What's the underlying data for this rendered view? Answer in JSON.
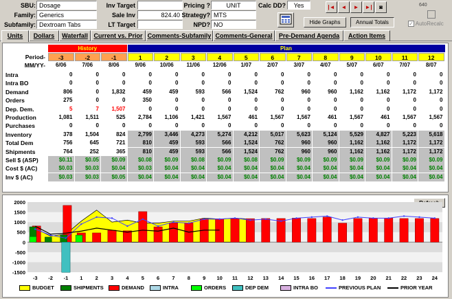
{
  "header": {
    "sbu_label": "SBU:",
    "sbu_value": "Dosage",
    "family_label": "Family:",
    "family_value": "Generics",
    "subfamily_label": "Subfamily:",
    "subfamily_value": "Dextroam Tabs",
    "inv_target_label": "Inv Target",
    "inv_target_value": "",
    "sale_inv_label": "Sale Inv",
    "sale_inv_value": "824.40",
    "lt_target_label": "LT Target",
    "lt_target_value": "",
    "pricing_label": "Pricing ?",
    "pricing_value": "UNIT",
    "strategy_label": "Strategy?",
    "strategy_value": "MTS",
    "npd_label": "NPD?",
    "npd_value": "NO",
    "calc_dd_label": "Calc DD?",
    "calc_dd_value": "Yes",
    "hide_graphs_label": "Hide Graphs",
    "annual_totals_label": "Annual Totals",
    "autorecalc_label": "AutoRecalc",
    "corner_number": "640"
  },
  "tabs": [
    "Units",
    "Dollars",
    "Waterfall",
    "Current vs. Prior",
    "Comments-Subfamily",
    "Comments-General",
    "Pre-Demand Agenda",
    "Action Items"
  ],
  "grid": {
    "history_label": "History",
    "plan_label": "Plan",
    "period_label": "Period-",
    "mmyy_label": "MM/YY-",
    "periods": [
      "-3",
      "-2",
      "-1",
      "1",
      "2",
      "3",
      "4",
      "5",
      "6",
      "7",
      "8",
      "9",
      "10",
      "11",
      "12"
    ],
    "dates": [
      "6/06",
      "7/06",
      "8/06",
      "9/06",
      "10/06",
      "11/06",
      "12/06",
      "1/07",
      "2/07",
      "3/07",
      "4/07",
      "5/07",
      "6/07",
      "7/07",
      "8/07"
    ],
    "rows": [
      {
        "label": "Intra",
        "values": [
          "0",
          "0",
          "0",
          "0",
          "0",
          "0",
          "0",
          "0",
          "0",
          "0",
          "0",
          "0",
          "0",
          "0",
          "0"
        ]
      },
      {
        "label": "Intra BO",
        "values": [
          "0",
          "0",
          "0",
          "0",
          "0",
          "0",
          "0",
          "0",
          "0",
          "0",
          "0",
          "0",
          "0",
          "0",
          "0"
        ]
      },
      {
        "label": "Demand",
        "values": [
          "806",
          "0",
          "1,832",
          "459",
          "459",
          "593",
          "566",
          "1,524",
          "762",
          "960",
          "960",
          "1,162",
          "1,162",
          "1,172",
          "1,172"
        ]
      },
      {
        "label": "Orders",
        "values": [
          "275",
          "0",
          "0",
          "350",
          "0",
          "0",
          "0",
          "0",
          "0",
          "0",
          "0",
          "0",
          "0",
          "0",
          "0"
        ]
      },
      {
        "label": "Dep. Dem.",
        "values": [
          "5",
          "7",
          "1,507",
          "0",
          "0",
          "0",
          "0",
          "0",
          "0",
          "0",
          "0",
          "0",
          "0",
          "0",
          "0"
        ]
      },
      {
        "label": "Production",
        "values": [
          "1,081",
          "1,511",
          "525",
          "2,784",
          "1,106",
          "1,421",
          "1,567",
          "461",
          "1,567",
          "1,567",
          "461",
          "1,567",
          "461",
          "1,567",
          "1,567"
        ]
      },
      {
        "label": "Purchases",
        "values": [
          "0",
          "0",
          "0",
          "0",
          "0",
          "0",
          "0",
          "0",
          "0",
          "0",
          "0",
          "0",
          "0",
          "0",
          "0"
        ]
      },
      {
        "label": "Inventory",
        "values": [
          "378",
          "1,504",
          "824",
          "2,799",
          "3,446",
          "4,273",
          "5,274",
          "4,212",
          "5,017",
          "5,623",
          "5,124",
          "5,529",
          "4,827",
          "5,223",
          "5,618"
        ]
      },
      {
        "label": "Total Dem",
        "values": [
          "756",
          "645",
          "721",
          "810",
          "459",
          "593",
          "566",
          "1,524",
          "762",
          "960",
          "960",
          "1,162",
          "1,162",
          "1,172",
          "1,172"
        ]
      },
      {
        "label": "Shipments",
        "values": [
          "764",
          "252",
          "365",
          "810",
          "459",
          "593",
          "566",
          "1,524",
          "762",
          "960",
          "960",
          "1,162",
          "1,162",
          "1,172",
          "1,172"
        ]
      },
      {
        "label": "Sell $ (ASP)",
        "values": [
          "$0.11",
          "$0.05",
          "$0.09",
          "$0.08",
          "$0.09",
          "$0.08",
          "$0.09",
          "$0.08",
          "$0.09",
          "$0.09",
          "$0.09",
          "$0.09",
          "$0.09",
          "$0.09",
          "$0.09"
        ]
      },
      {
        "label": "Cost $ (AC)",
        "values": [
          "$0.03",
          "$0.03",
          "$0.04",
          "$0.03",
          "$0.04",
          "$0.04",
          "$0.04",
          "$0.04",
          "$0.04",
          "$0.04",
          "$0.04",
          "$0.04",
          "$0.04",
          "$0.04",
          "$0.04"
        ]
      },
      {
        "label": "Inv $ (AC)",
        "values": [
          "$0.03",
          "$0.03",
          "$0.05",
          "$0.04",
          "$0.04",
          "$0.04",
          "$0.04",
          "$0.04",
          "$0.04",
          "$0.04",
          "$0.04",
          "$0.04",
          "$0.04",
          "$0.04",
          "$0.04"
        ]
      }
    ]
  },
  "chart_data": {
    "type": "bar",
    "refresh_label": "Refresh",
    "categories": [
      "-3",
      "-2",
      "-1",
      "1",
      "2",
      "3",
      "4",
      "5",
      "6",
      "7",
      "8",
      "9",
      "10",
      "11",
      "12",
      "13",
      "14",
      "15",
      "16",
      "17",
      "18",
      "19",
      "20",
      "21",
      "22",
      "23",
      "24"
    ],
    "ylim": [
      -1500,
      2000
    ],
    "yticks": [
      "2000",
      "1500",
      "1000",
      "500",
      "0",
      "-500",
      "-1000",
      "-1500"
    ],
    "series": [
      {
        "name": "BUDGET",
        "color": "#ffff00",
        "values": [
          700,
          300,
          400,
          1050,
          1600,
          1000,
          1100,
          950,
          950,
          1050,
          1050,
          1200,
          1150,
          1200,
          1150,
          null,
          null,
          null,
          null,
          null,
          null,
          null,
          null,
          null,
          null,
          null,
          null
        ]
      },
      {
        "name": "SHIPMENTS",
        "color": "#008000",
        "values": [
          764,
          252,
          365,
          null,
          null,
          null,
          null,
          null,
          null,
          null,
          null,
          null,
          null,
          null,
          null,
          null,
          null,
          null,
          null,
          null,
          null,
          null,
          null,
          null,
          null,
          null,
          null
        ]
      },
      {
        "name": "DEMAND",
        "color": "#ff0000",
        "values": [
          806,
          0,
          1832,
          459,
          459,
          593,
          566,
          1524,
          762,
          960,
          960,
          1162,
          1162,
          1172,
          1172,
          1180,
          1180,
          1200,
          1180,
          1250,
          950,
          1180,
          1200,
          1200,
          1180,
          1180,
          1180
        ]
      },
      {
        "name": "INTRA",
        "color": "#add8e6",
        "values": []
      },
      {
        "name": "ORDERS",
        "color": "#00ff00",
        "values": [
          275,
          0,
          0,
          350,
          0,
          0,
          0,
          0,
          0,
          0,
          0,
          0,
          0,
          0,
          0
        ]
      },
      {
        "name": "DEP DEM",
        "color": "#40c0c0",
        "values": [
          5,
          7,
          -1507,
          0,
          0,
          0,
          0,
          0,
          0,
          0,
          0,
          0,
          0,
          0,
          0
        ]
      },
      {
        "name": "INTRA BO",
        "color": "#d8b0e0",
        "values": []
      },
      {
        "name": "PREVIOUS PLAN",
        "color": "#4040ff",
        "values": [
          650,
          350,
          200,
          900,
          1250,
          1200,
          800,
          1150,
          800,
          1000,
          950,
          1150,
          1150,
          1200,
          1100,
          1150,
          1050,
          1200,
          1250,
          1300,
          1100,
          1250,
          1200,
          1200,
          1300,
          1250,
          1200
        ]
      },
      {
        "name": "PRIOR YEAR",
        "color": "#000000",
        "values": [
          800,
          400,
          450,
          550,
          700,
          600,
          500,
          600,
          550,
          700,
          500,
          600,
          600,
          null,
          null,
          null,
          null,
          null,
          null,
          null,
          null,
          null,
          null,
          null,
          null,
          null,
          null
        ]
      }
    ]
  }
}
